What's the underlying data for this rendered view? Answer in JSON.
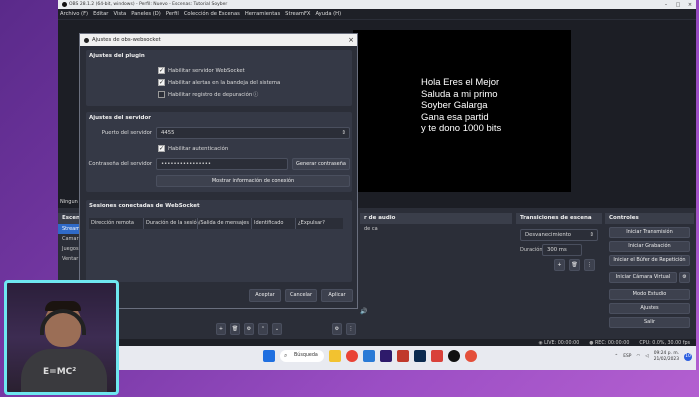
{
  "window": {
    "title": "OBS 28.1.2 (64-bit, windows) - Perfil: Nuevo - Escenas: Tutorial Soyber"
  },
  "menu": [
    "Archivo (F)",
    "Editar",
    "Vista",
    "Paneles (D)",
    "Perfil",
    "Colección de Escenas",
    "Herramientas",
    "StreamFX",
    "Ayuda (H)"
  ],
  "preview": {
    "lines": [
      "Hola Eres el Mejor",
      "Saluda a mi primo",
      "Soyber Galarga",
      "Gana esa partid",
      "y te dono 1000 bits"
    ]
  },
  "dialog": {
    "title": "Ajustes de obs-websocket",
    "plugin_group": "Ajustes del plugin",
    "enable_ws": "Habilitar servidor WebSocket",
    "tray_alerts": "Habilitar alertas en la bandeja del sistema",
    "debug_log": "Habilitar registro de depuración",
    "server_group": "Ajustes del servidor",
    "port_label": "Puerto del servidor",
    "port_value": "4455",
    "auth": "Habilitar autenticación",
    "password_label": "Contraseña del servidor",
    "password_value": "••••••••••••••••",
    "generate_password": "Generar contraseña",
    "show_connection": "Mostrar información de conexión",
    "sessions_group": "Sesiones conectadas de WebSocket",
    "columns": [
      "Dirección remota",
      "Duración de la sesión",
      "Entrada/Salida de mensajes",
      "Identificado",
      "¿Expulsar?"
    ],
    "ok": "Aceptar",
    "cancel": "Cancelar",
    "apply": "Aplicar"
  },
  "docks": {
    "left_stub": "Ningun",
    "scenes_head": "Escen",
    "scenes": [
      "Stream",
      "Camar",
      "Juegos",
      "Ventar"
    ],
    "audio_head": "r de audio",
    "audio_item": "de ca",
    "transitions_head": "Transiciones de escena",
    "transition_value": "Desvanecimiento",
    "duration_label": "Duración",
    "duration_value": "300 ms",
    "controls_head": "Controles",
    "controls": [
      "Iniciar Transmisión",
      "Iniciar Grabación",
      "Iniciar el Búfer de Repetición",
      "Iniciar Cámara Virtual",
      "Modo Estudio",
      "Ajustes",
      "Salir"
    ]
  },
  "status": {
    "live": "LIVE: 00:00:00",
    "rec": "REC: 00:00:00",
    "cpu": "CPU: 0.0%, 30.00 fps"
  },
  "taskbar": {
    "search": "Búsqueda",
    "lang": "ESP",
    "time": "09:24 p. m.",
    "date": "21/02/2023",
    "notifications": "10"
  },
  "cam": {
    "shirt_text": "E=MC²"
  }
}
